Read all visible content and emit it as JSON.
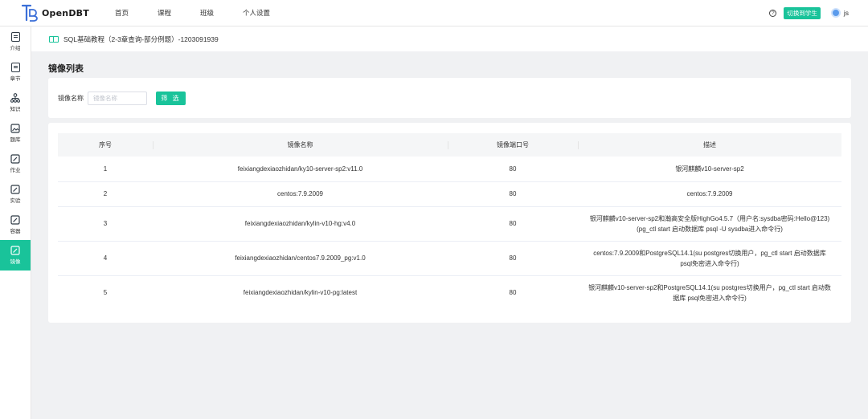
{
  "app": {
    "logo_text": "OpenDBT",
    "nav": [
      "首页",
      "课程",
      "班级",
      "个人设置"
    ],
    "help_glyph": "?",
    "switch_label": "切换到学生",
    "username": "js"
  },
  "sidebar": {
    "items": [
      {
        "label": "介绍",
        "icon": "document-icon"
      },
      {
        "label": "章节",
        "icon": "document-icon"
      },
      {
        "label": "知识",
        "icon": "tree-icon"
      },
      {
        "label": "题库",
        "icon": "image-icon"
      },
      {
        "label": "作业",
        "icon": "edit-icon"
      },
      {
        "label": "实验",
        "icon": "edit-icon"
      },
      {
        "label": "容器",
        "icon": "edit-icon"
      },
      {
        "label": "镜像",
        "icon": "edit-icon",
        "active": true
      }
    ]
  },
  "breadcrumb": {
    "text": "SQL基础教程（2-3章查询-部分例题）-1203091939"
  },
  "page": {
    "title": "镜像列表"
  },
  "filter": {
    "label": "镜像名称",
    "placeholder": "镜像名称",
    "button": "筛 选"
  },
  "table": {
    "headers": [
      "序号",
      "镜像名称",
      "镜像端口号",
      "描述"
    ],
    "rows": [
      {
        "no": "1",
        "name": "feixiangdexiaozhidan/ky10-server-sp2:v11.0",
        "port": "80",
        "desc": [
          "银河麒麟v10-server-sp2"
        ]
      },
      {
        "no": "2",
        "name": "centos:7.9.2009",
        "port": "80",
        "desc": [
          "centos:7.9.2009"
        ]
      },
      {
        "no": "3",
        "name": "feixiangdexiaozhidan/kylin-v10-hg:v4.0",
        "port": "80",
        "desc": [
          "银河麒麟v10-server-sp2和瀚高安全版HighGo4.5.7（用户名:sysdba密码:Hello@123)",
          "(pg_ctl start 启动数据库 psql -U sysdba进入命令行)"
        ]
      },
      {
        "no": "4",
        "name": "feixiangdexiaozhidan/centos7.9.2009_pg:v1.0",
        "port": "80",
        "desc": [
          "centos:7.9.2009和PostgreSQL14.1(su postgres切换用户，pg_ctl start 启动数据库",
          "psql免密进入命令行)"
        ]
      },
      {
        "no": "5",
        "name": "feixiangdexiaozhidan/kylin-v10-pg:latest",
        "port": "80",
        "desc": [
          "银河麒麟v10-server-sp2和PostgreSQL14.1(su postgres切换用户，pg_ctl start 启动数",
          "据库 psql免密进入命令行)"
        ]
      }
    ]
  },
  "colors": {
    "accent": "#19c39a",
    "avatar": "#5b9bec",
    "background": "#f0f1f3"
  }
}
